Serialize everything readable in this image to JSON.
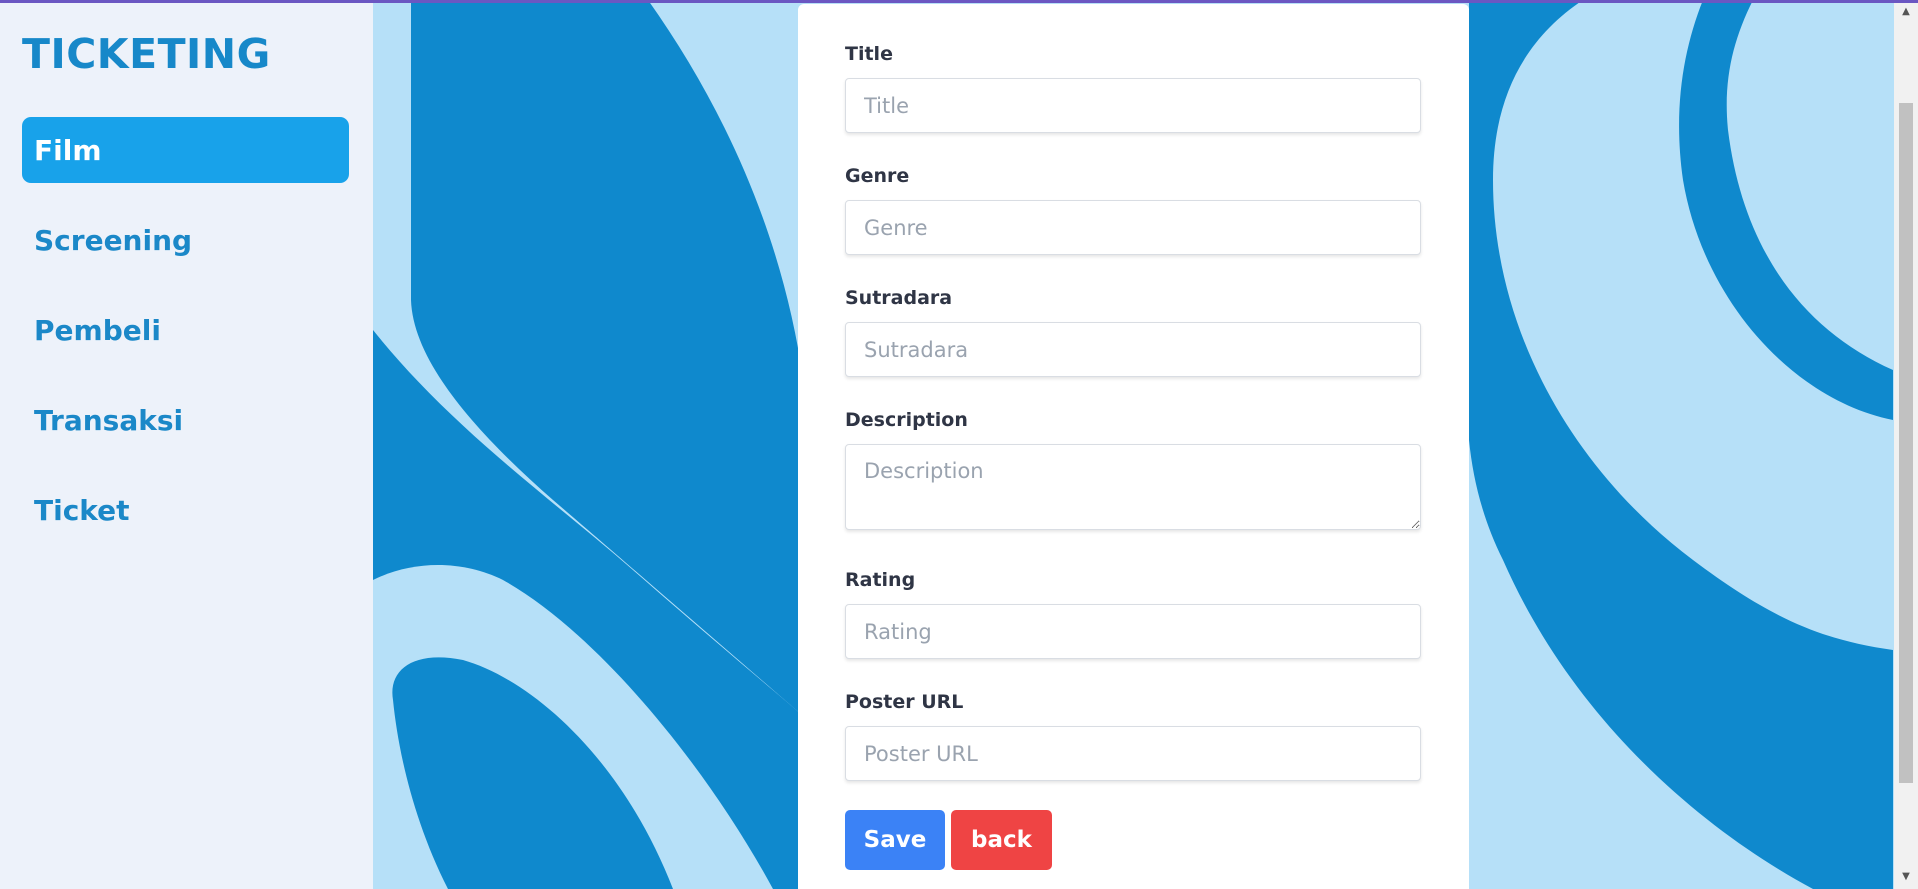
{
  "sidebar": {
    "brand": "TICKETING",
    "items": [
      {
        "label": "Film",
        "active": true
      },
      {
        "label": "Screening",
        "active": false
      },
      {
        "label": "Pembeli",
        "active": false
      },
      {
        "label": "Transaksi",
        "active": false
      },
      {
        "label": "Ticket",
        "active": false
      }
    ]
  },
  "form": {
    "title": {
      "label": "Title",
      "placeholder": "Title"
    },
    "genre": {
      "label": "Genre",
      "placeholder": "Genre"
    },
    "sutradara": {
      "label": "Sutradara",
      "placeholder": "Sutradara"
    },
    "description": {
      "label": "Description",
      "placeholder": "Description"
    },
    "rating": {
      "label": "Rating",
      "placeholder": "Rating"
    },
    "poster_url": {
      "label": "Poster URL",
      "placeholder": "Poster URL"
    },
    "save_label": "Save",
    "back_label": "back"
  },
  "colors": {
    "brand": "#1788c9",
    "active_nav": "#18a2ea",
    "save": "#3b82f6",
    "back": "#ef4444",
    "bg_light": "#b6e0f8",
    "bg_dark": "#0f89cd"
  },
  "scrollbar": {
    "up_icon": "triangle-up",
    "down_icon": "triangle-down"
  }
}
